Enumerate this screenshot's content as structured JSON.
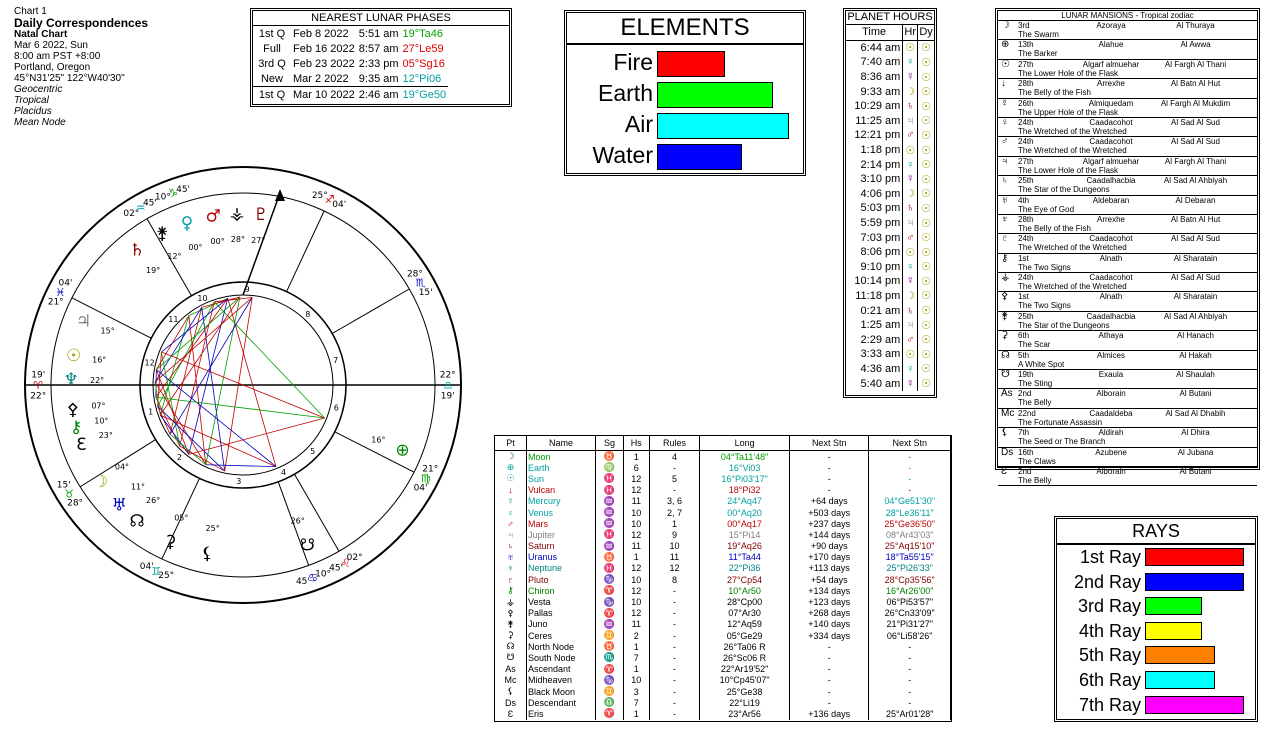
{
  "chart_info": {
    "line1": "Chart 1",
    "line2": "Daily Correspondences",
    "line3": "Natal Chart",
    "line4": "Mar 6 2022, Sun",
    "line5": "8:00 am  PST +8:00",
    "line6": "Portland, Oregon",
    "line7": "45°N31'25\"  122°W40'30\"",
    "line8": "Geocentric",
    "line9": "Tropical",
    "line10": "Placidus",
    "line11": "Mean Node"
  },
  "lunar_phases": {
    "title": "NEAREST LUNAR PHASES",
    "rows": [
      {
        "phase": "1st Q",
        "date": "Feb 8 2022",
        "time": "5:51 am",
        "pos": "19°Ta46",
        "color": "#00a000"
      },
      {
        "phase": "Full",
        "date": "Feb 16 2022",
        "time": "8:57 am",
        "pos": "27°Le59",
        "color": "#e00000"
      },
      {
        "phase": "3rd Q",
        "date": "Feb 23 2022",
        "time": "2:33 pm",
        "pos": "05°Sg16",
        "color": "#e00000"
      },
      {
        "phase": "New",
        "date": "Mar 2 2022",
        "time": "9:35 am",
        "pos": "12°Pi06",
        "color": "#00a0a0"
      },
      {
        "phase": "1st Q",
        "date": "Mar 10 2022",
        "time": "2:46 am",
        "pos": "19°Ge50",
        "color": "#00a0a0"
      }
    ]
  },
  "elements": {
    "title": "ELEMENTS",
    "items": [
      {
        "label": "Fire",
        "value": 0.49,
        "color": "#ff0000"
      },
      {
        "label": "Earth",
        "value": 0.85,
        "color": "#00ff00"
      },
      {
        "label": "Air",
        "value": 0.97,
        "color": "#00ffff"
      },
      {
        "label": "Water",
        "value": 0.62,
        "color": "#0000ff"
      }
    ]
  },
  "planet_hours": {
    "title": "PLANET HOURS",
    "headers": [
      "Time",
      "Hr",
      "Dy"
    ],
    "rows": [
      {
        "time": "6:44 am",
        "hr": "☉",
        "dy": "☉"
      },
      {
        "time": "7:40 am",
        "hr": "♀",
        "dy": "☉"
      },
      {
        "time": "8:36 am",
        "hr": "☿",
        "dy": "☉"
      },
      {
        "time": "9:33 am",
        "hr": "☽",
        "dy": "☉"
      },
      {
        "time": "10:29 am",
        "hr": "♄",
        "dy": "☉"
      },
      {
        "time": "11:25 am",
        "hr": "♃",
        "dy": "☉"
      },
      {
        "time": "12:21 pm",
        "hr": "♂",
        "dy": "☉"
      },
      {
        "time": "1:18 pm",
        "hr": "☉",
        "dy": "☉"
      },
      {
        "time": "2:14 pm",
        "hr": "♀",
        "dy": "☉"
      },
      {
        "time": "3:10 pm",
        "hr": "☿",
        "dy": "☉"
      },
      {
        "time": "4:06 pm",
        "hr": "☽",
        "dy": "☉"
      },
      {
        "time": "5:03 pm",
        "hr": "♄",
        "dy": "☉"
      },
      {
        "time": "5:59 pm",
        "hr": "♃",
        "dy": "☉"
      },
      {
        "time": "7:03 pm",
        "hr": "♂",
        "dy": "☉"
      },
      {
        "time": "8:06 pm",
        "hr": "☉",
        "dy": "☉"
      },
      {
        "time": "9:10 pm",
        "hr": "♀",
        "dy": "☉"
      },
      {
        "time": "10:14 pm",
        "hr": "☿",
        "dy": "☉"
      },
      {
        "time": "11:18 pm",
        "hr": "☽",
        "dy": "☉"
      },
      {
        "time": "0:21 am",
        "hr": "♄",
        "dy": "☉"
      },
      {
        "time": "1:25 am",
        "hr": "♃",
        "dy": "☉"
      },
      {
        "time": "2:29 am",
        "hr": "♂",
        "dy": "☉"
      },
      {
        "time": "3:33 am",
        "hr": "☉",
        "dy": "☉"
      },
      {
        "time": "4:36 am",
        "hr": "♀",
        "dy": "☉"
      },
      {
        "time": "5:40 am",
        "hr": "☿",
        "dy": "☉"
      }
    ]
  },
  "mansions": {
    "title": "LUNAR MANSIONS - Tropical zodiac",
    "rows": [
      {
        "g": "☽",
        "num": "3rd",
        "a": "Azoraya",
        "b": "Al Thuraya",
        "d": "The Swarm"
      },
      {
        "g": "⊕",
        "num": "13th",
        "a": "Alahue",
        "b": "Al Awwa",
        "d": "The Barker"
      },
      {
        "g": "☉",
        "num": "27th",
        "a": "Algarf almuehar",
        "b": "Al Fargh Al Thani",
        "d": "The Lower Hole of the Flask"
      },
      {
        "g": "↓",
        "num": "28th",
        "a": "Arrexhe",
        "b": "Al Batn Al Hut",
        "d": "The Belly of the Fish"
      },
      {
        "g": "☿",
        "num": "26th",
        "a": "Almiquedam",
        "b": "Al Fargh Al Mukdim",
        "d": "The Upper Hole of the Flask"
      },
      {
        "g": "♀",
        "num": "24th",
        "a": "Caadacohot",
        "b": "Al Sad Al Sud",
        "d": "The Wretched of the Wretched"
      },
      {
        "g": "♂",
        "num": "24th",
        "a": "Caadacohot",
        "b": "Al Sad Al Sud",
        "d": "The Wretched of the Wretched"
      },
      {
        "g": "♃",
        "num": "27th",
        "a": "Algarf almuehar",
        "b": "Al Fargh Al Thani",
        "d": "The Lower Hole of the Flask"
      },
      {
        "g": "♄",
        "num": "25th",
        "a": "Caadalhacbia",
        "b": "Al Sad Al Ahbiyah",
        "d": "The Star of the Dungeons"
      },
      {
        "g": "♅",
        "num": "4th",
        "a": "Aldebaran",
        "b": "Al Debaran",
        "d": "The Eye of God"
      },
      {
        "g": "♆",
        "num": "28th",
        "a": "Arrexhe",
        "b": "Al Batn Al Hut",
        "d": "The Belly of the Fish"
      },
      {
        "g": "♇",
        "num": "24th",
        "a": "Caadacohot",
        "b": "Al Sad Al Sud",
        "d": "The Wretched of the Wretched"
      },
      {
        "g": "⚷",
        "num": "1st",
        "a": "Alnath",
        "b": "Al Sharatain",
        "d": "The Two Signs"
      },
      {
        "g": "⚶",
        "num": "24th",
        "a": "Caadacohot",
        "b": "Al Sad Al Sud",
        "d": "The Wretched of the Wretched"
      },
      {
        "g": "⚴",
        "num": "1st",
        "a": "Alnath",
        "b": "Al Sharatain",
        "d": "The Two Signs"
      },
      {
        "g": "⚵",
        "num": "25th",
        "a": "Caadalhacbia",
        "b": "Al Sad Al Ahbiyah",
        "d": "The Star of the Dungeons"
      },
      {
        "g": "⚳",
        "num": "6th",
        "a": "Athaya",
        "b": "Al Hanach",
        "d": "The Scar"
      },
      {
        "g": "☊",
        "num": "5th",
        "a": "Almices",
        "b": "Al Hakah",
        "d": "A White Spot"
      },
      {
        "g": "☋",
        "num": "19th",
        "a": "Exaula",
        "b": "Al Shaulah",
        "d": "The Sting"
      },
      {
        "g": "As",
        "num": "2nd",
        "a": "Alborain",
        "b": "Al Butani",
        "d": "The Belly"
      },
      {
        "g": "Mc",
        "num": "22nd",
        "a": "Caadaldeba",
        "b": "Al Sad Al Dhabih",
        "d": "The Fortunate Assassin"
      },
      {
        "g": "⚸",
        "num": "7th",
        "a": "Aldirah",
        "b": "Al Dhira",
        "d": "The Seed or The Branch"
      },
      {
        "g": "Ds",
        "num": "16th",
        "a": "Azubene",
        "b": "Al Jubana",
        "d": "The Claws"
      },
      {
        "g": "Ɛ",
        "num": "2nd",
        "a": "Alborain",
        "b": "Al Butani",
        "d": "The Belly"
      }
    ]
  },
  "planets_table": {
    "headers": [
      "Pt",
      "Name",
      "Sg",
      "Hs",
      "Rules",
      "Long",
      "Next Stn",
      "Next Stn"
    ],
    "rows": [
      {
        "g": "☽",
        "name": "Moon",
        "sg": "♉",
        "hs": "1",
        "rules": "4",
        "long": "04°Ta11'48\"",
        "ns1": "-",
        "ns2": "-",
        "c": "#00a000"
      },
      {
        "g": "⊕",
        "name": "Earth",
        "sg": "♍",
        "hs": "6",
        "rules": "-",
        "long": "16°Vi03",
        "ns1": "-",
        "ns2": "-",
        "c": "#00a0a0"
      },
      {
        "g": "☉",
        "name": "Sun",
        "sg": "♓",
        "hs": "12",
        "rules": "5",
        "long": "16°Pi03'17\"",
        "ns1": "-",
        "ns2": "-",
        "c": "#00a0a0"
      },
      {
        "g": "↓",
        "name": "Vulcan",
        "sg": "♓",
        "hs": "12",
        "rules": "-",
        "long": "18°Pi32",
        "ns1": "-",
        "ns2": "-",
        "c": "#c00000"
      },
      {
        "g": "☿",
        "name": "Mercury",
        "sg": "♒",
        "hs": "11",
        "rules": "3, 6",
        "long": "24°Aq47",
        "ns1": "+64 days",
        "ns2": "04°Ge51'30\"",
        "c": "#00a0a0"
      },
      {
        "g": "♀",
        "name": "Venus",
        "sg": "♒",
        "hs": "10",
        "rules": "2, 7",
        "long": "00°Aq20",
        "ns1": "+503 days",
        "ns2": "28°Le36'11\"",
        "c": "#00a0a0"
      },
      {
        "g": "♂",
        "name": "Mars",
        "sg": "♒",
        "hs": "10",
        "rules": "1",
        "long": "00°Aq17",
        "ns1": "+237 days",
        "ns2": "25°Ge36'50\"",
        "c": "#c00000"
      },
      {
        "g": "♃",
        "name": "Jupiter",
        "sg": "♓",
        "hs": "12",
        "rules": "9",
        "long": "15°Pi14",
        "ns1": "+144 days",
        "ns2": "08°Ar43'03\"",
        "c": "#808080"
      },
      {
        "g": "♄",
        "name": "Saturn",
        "sg": "♒",
        "hs": "11",
        "rules": "10",
        "long": "19°Aq26",
        "ns1": "+90 days",
        "ns2": "25°Aq15'10\"",
        "c": "#800000"
      },
      {
        "g": "♅",
        "name": "Uranus",
        "sg": "♉",
        "hs": "1",
        "rules": "11",
        "long": "11°Ta44",
        "ns1": "+170 days",
        "ns2": "18°Ta55'15\"",
        "c": "#0000c0"
      },
      {
        "g": "♆",
        "name": "Neptune",
        "sg": "♓",
        "hs": "12",
        "rules": "12",
        "long": "22°Pi36",
        "ns1": "+113 days",
        "ns2": "25°Pi26'33\"",
        "c": "#008080"
      },
      {
        "g": "♇",
        "name": "Pluto",
        "sg": "♑",
        "hs": "10",
        "rules": "8",
        "long": "27°Cp54",
        "ns1": "+54 days",
        "ns2": "28°Cp35'56\"",
        "c": "#800000"
      },
      {
        "g": "⚷",
        "name": "Chiron",
        "sg": "♈",
        "hs": "12",
        "rules": "-",
        "long": "10°Ar50",
        "ns1": "+134 days",
        "ns2": "16°Ar26'00\"",
        "c": "#008000"
      },
      {
        "g": "⚶",
        "name": "Vesta",
        "sg": "♑",
        "hs": "10",
        "rules": "-",
        "long": "28°Cp00",
        "ns1": "+123 days",
        "ns2": "06°Pi53'57\"",
        "c": "#000000"
      },
      {
        "g": "⚴",
        "name": "Pallas",
        "sg": "♈",
        "hs": "12",
        "rules": "-",
        "long": "07°Ar30",
        "ns1": "+268 days",
        "ns2": "26°Cn33'09\"",
        "c": "#000000"
      },
      {
        "g": "⚵",
        "name": "Juno",
        "sg": "♒",
        "hs": "11",
        "rules": "-",
        "long": "12°Aq59",
        "ns1": "+140 days",
        "ns2": "21°Pi31'27\"",
        "c": "#000000"
      },
      {
        "g": "⚳",
        "name": "Ceres",
        "sg": "♊",
        "hs": "2",
        "rules": "-",
        "long": "05°Ge29",
        "ns1": "+334 days",
        "ns2": "06°Li58'26\"",
        "c": "#000000"
      },
      {
        "g": "☊",
        "name": "North Node",
        "sg": "♉",
        "hs": "1",
        "rules": "-",
        "long": "26°Ta06 R",
        "ns1": "-",
        "ns2": "-",
        "c": "#000000"
      },
      {
        "g": "☋",
        "name": "South Node",
        "sg": "♏",
        "hs": "7",
        "rules": "-",
        "long": "26°Sc06 R",
        "ns1": "-",
        "ns2": "-",
        "c": "#000000"
      },
      {
        "g": "As",
        "name": "Ascendant",
        "sg": "♈",
        "hs": "1",
        "rules": "-",
        "long": "22°Ar19'52\"",
        "ns1": "-",
        "ns2": "-",
        "c": "#000000"
      },
      {
        "g": "Mc",
        "name": "Midheaven",
        "sg": "♑",
        "hs": "10",
        "rules": "-",
        "long": "10°Cp45'07\"",
        "ns1": "-",
        "ns2": "-",
        "c": "#000000"
      },
      {
        "g": "⚸",
        "name": "Black Moon",
        "sg": "♊",
        "hs": "3",
        "rules": "-",
        "long": "25°Ge38",
        "ns1": "-",
        "ns2": "-",
        "c": "#000000"
      },
      {
        "g": "Ds",
        "name": "Descendant",
        "sg": "♎",
        "hs": "7",
        "rules": "-",
        "long": "22°Li19",
        "ns1": "-",
        "ns2": "-",
        "c": "#000000"
      },
      {
        "g": "Ɛ",
        "name": "Eris",
        "sg": "♈",
        "hs": "1",
        "rules": "-",
        "long": "23°Ar56",
        "ns1": "+136 days",
        "ns2": "25°Ar01'28\"",
        "c": "#000000"
      }
    ]
  },
  "rays": {
    "title": "RAYS",
    "items": [
      {
        "label": "1st Ray",
        "value": 0.97,
        "color": "#ff0000"
      },
      {
        "label": "2nd Ray",
        "value": 0.97,
        "color": "#0000ff"
      },
      {
        "label": "3rd Ray",
        "value": 0.55,
        "color": "#00ff00"
      },
      {
        "label": "4th Ray",
        "value": 0.55,
        "color": "#ffff00"
      },
      {
        "label": "5th Ray",
        "value": 0.68,
        "color": "#ff8000"
      },
      {
        "label": "6th Ray",
        "value": 0.68,
        "color": "#00ffff"
      },
      {
        "label": "7th Ray",
        "value": 0.97,
        "color": "#ff00ff"
      }
    ]
  },
  "wheel": {
    "house_cusps": [
      {
        "deg": "22°",
        "min": "19'",
        "sign": "♈",
        "color": "#c00000"
      },
      {
        "deg": "28°",
        "min": "15'",
        "sign": "♉",
        "color": "#00a000"
      },
      {
        "deg": "25°",
        "min": "04'",
        "sign": "♊",
        "color": "#00a0a0"
      },
      {
        "deg": "10°",
        "min": "45'",
        "sign": "♋",
        "color": "#0000c0"
      },
      {
        "deg": "02°",
        "min": "45'",
        "sign": "♌",
        "color": "#c00000"
      },
      {
        "deg": "21°",
        "min": "04'",
        "sign": "♍",
        "color": "#00a000"
      },
      {
        "deg": "22°",
        "min": "19'",
        "sign": "♎",
        "color": "#00a0a0"
      },
      {
        "deg": "28°",
        "min": "15'",
        "sign": "♏",
        "color": "#0000c0"
      },
      {
        "deg": "25°",
        "min": "04'",
        "sign": "♐",
        "color": "#c00000"
      },
      {
        "deg": "10°",
        "min": "45'",
        "sign": "♑",
        "color": "#00a000"
      },
      {
        "deg": "02°",
        "min": "45'",
        "sign": "♒",
        "color": "#00a0a0"
      },
      {
        "deg": "21°",
        "min": "04'",
        "sign": "♓",
        "color": "#0000c0"
      }
    ],
    "planet_glyphs": [
      {
        "g": "♄",
        "label": "19°",
        "color": "#800000"
      },
      {
        "g": "⚵",
        "label": "12°",
        "color": "#000000"
      },
      {
        "g": "♀",
        "label": "00°",
        "color": "#00a0a0"
      },
      {
        "g": "♂",
        "label": "00°",
        "color": "#c00000"
      },
      {
        "g": "⚶",
        "label": "28°",
        "color": "#000000"
      },
      {
        "g": "♇",
        "label": "27°",
        "color": "#800000"
      },
      {
        "g": "♃",
        "label": "15°",
        "color": "#808080"
      },
      {
        "g": "☉",
        "label": "16°",
        "color": "#a0a000"
      },
      {
        "g": "♆",
        "label": "22°",
        "color": "#008080"
      },
      {
        "g": "⚷",
        "label": "10°",
        "color": "#008000"
      },
      {
        "g": "⚴",
        "label": "07°",
        "color": "#000000"
      },
      {
        "g": "Ɛ",
        "label": "23°",
        "color": "#000000"
      },
      {
        "g": "☽",
        "label": "04°",
        "color": "#a0a000"
      },
      {
        "g": "♅",
        "label": "11°",
        "color": "#0000c0"
      },
      {
        "g": "☊",
        "label": "26°",
        "color": "#000000"
      },
      {
        "g": "⚳",
        "label": "05°",
        "color": "#000000"
      },
      {
        "g": "⚸",
        "label": "25°",
        "color": "#000000"
      },
      {
        "g": "⊕",
        "label": "16°",
        "color": "#008000"
      },
      {
        "g": "☋",
        "label": "26°",
        "color": "#000000"
      }
    ],
    "house_numbers": [
      "1",
      "2",
      "3",
      "4",
      "5",
      "6",
      "7",
      "8",
      "9",
      "10",
      "11",
      "12"
    ]
  }
}
